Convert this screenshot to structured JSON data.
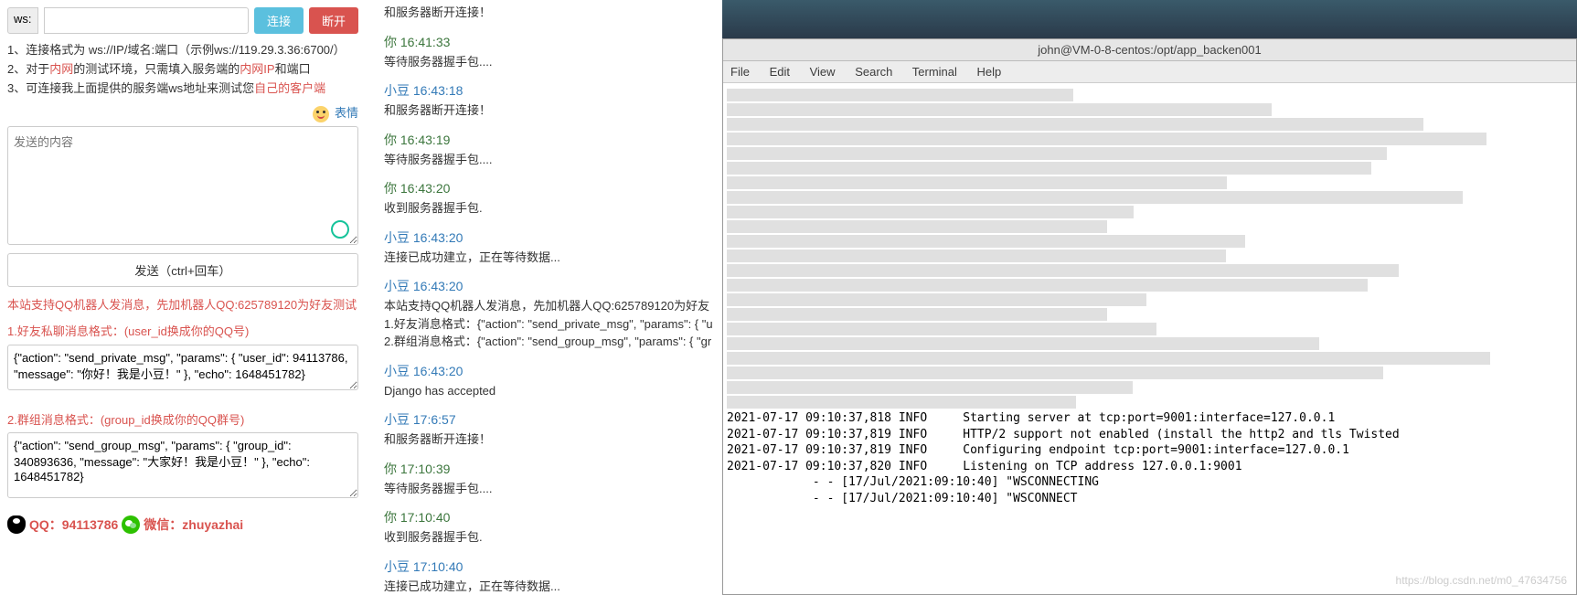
{
  "ws": {
    "prefix": "ws:",
    "value": "",
    "connect": "连接",
    "disconnect": "断开"
  },
  "instructions": {
    "line1_a": "1、连接格式为 ws://IP/域名:端口（示例ws://119.29.3.36:6700/）",
    "line2_a": "2、对于",
    "line2_red1": "内网",
    "line2_b": "的测试环境，只需填入服务端的",
    "line2_red2": "内网IP",
    "line2_c": "和端口",
    "line3_a": "3、可连接我上面提供的服务端ws地址来测试您",
    "line3_red": "自己的客户端"
  },
  "emoji_label": "表情",
  "msg_placeholder": "发送的内容",
  "send_label": "发送（ctrl+回车）",
  "notice_title": "本站支持QQ机器人发消息，先加机器人QQ:625789120为好友测试",
  "notice_private": "1.好友私聊消息格式：(user_id换成你的QQ号)",
  "example_private": "{\"action\": \"send_private_msg\", \"params\": { \"user_id\": 94113786, \"message\": \"你好！我是小豆！\" }, \"echo\": 1648451782}",
  "notice_group": "2.群组消息格式：(group_id换成你的QQ群号)",
  "example_group": "{\"action\": \"send_group_msg\", \"params\": { \"group_id\": 340893636, \"message\": \"大家好！我是小豆！\" }, \"echo\": 1648451782}",
  "contact_qq": "QQ：94113786",
  "contact_wx": "微信：zhuyazhai",
  "logs": [
    {
      "who": "bot",
      "title": "",
      "body": "和服务器断开连接！",
      "cut": true
    },
    {
      "who": "you",
      "title": "你 16:41:33",
      "body": "等待服务器握手包...."
    },
    {
      "who": "bot",
      "title": "小豆 16:43:18",
      "body": "和服务器断开连接！"
    },
    {
      "who": "you",
      "title": "你 16:43:19",
      "body": "等待服务器握手包...."
    },
    {
      "who": "you",
      "title": "你 16:43:20",
      "body": "收到服务器握手包."
    },
    {
      "who": "bot",
      "title": "小豆 16:43:20",
      "body": "连接已成功建立，正在等待数据..."
    },
    {
      "who": "bot",
      "title": "小豆 16:43:20",
      "body": "本站支持QQ机器人发消息，先加机器人QQ:625789120为好友\n1.好友消息格式：{\"action\": \"send_private_msg\", \"params\": { \"u\n2.群组消息格式：{\"action\": \"send_group_msg\", \"params\": { \"gr"
    },
    {
      "who": "bot",
      "title": "小豆 16:43:20",
      "body": "Django has accepted"
    },
    {
      "who": "bot",
      "title": "小豆 17:6:57",
      "body": "和服务器断开连接！"
    },
    {
      "who": "you",
      "title": "你 17:10:39",
      "body": "等待服务器握手包...."
    },
    {
      "who": "you",
      "title": "你 17:10:40",
      "body": "收到服务器握手包."
    },
    {
      "who": "bot",
      "title": "小豆 17:10:40",
      "body": "连接已成功建立，正在等待数据..."
    }
  ],
  "terminal": {
    "title": "john@VM-0-8-centos:/opt/app_backen001",
    "menu": [
      "File",
      "Edit",
      "View",
      "Search",
      "Terminal",
      "Help"
    ],
    "lines": [
      "2021-07-17 09:10:37,818 INFO     Starting server at tcp:port=9001:interface=127.0.0.1",
      "2021-07-17 09:10:37,819 INFO     HTTP/2 support not enabled (install the http2 and tls Twisted",
      "2021-07-17 09:10:37,819 INFO     Configuring endpoint tcp:port=9001:interface=127.0.0.1",
      "2021-07-17 09:10:37,820 INFO     Listening on TCP address 127.0.0.1:9001",
      "            - - [17/Jul/2021:09:10:40] \"WSCONNECTING",
      "            - - [17/Jul/2021:09:10:40] \"WSCONNECT"
    ],
    "watermark": "https://blog.csdn.net/m0_47634756"
  }
}
